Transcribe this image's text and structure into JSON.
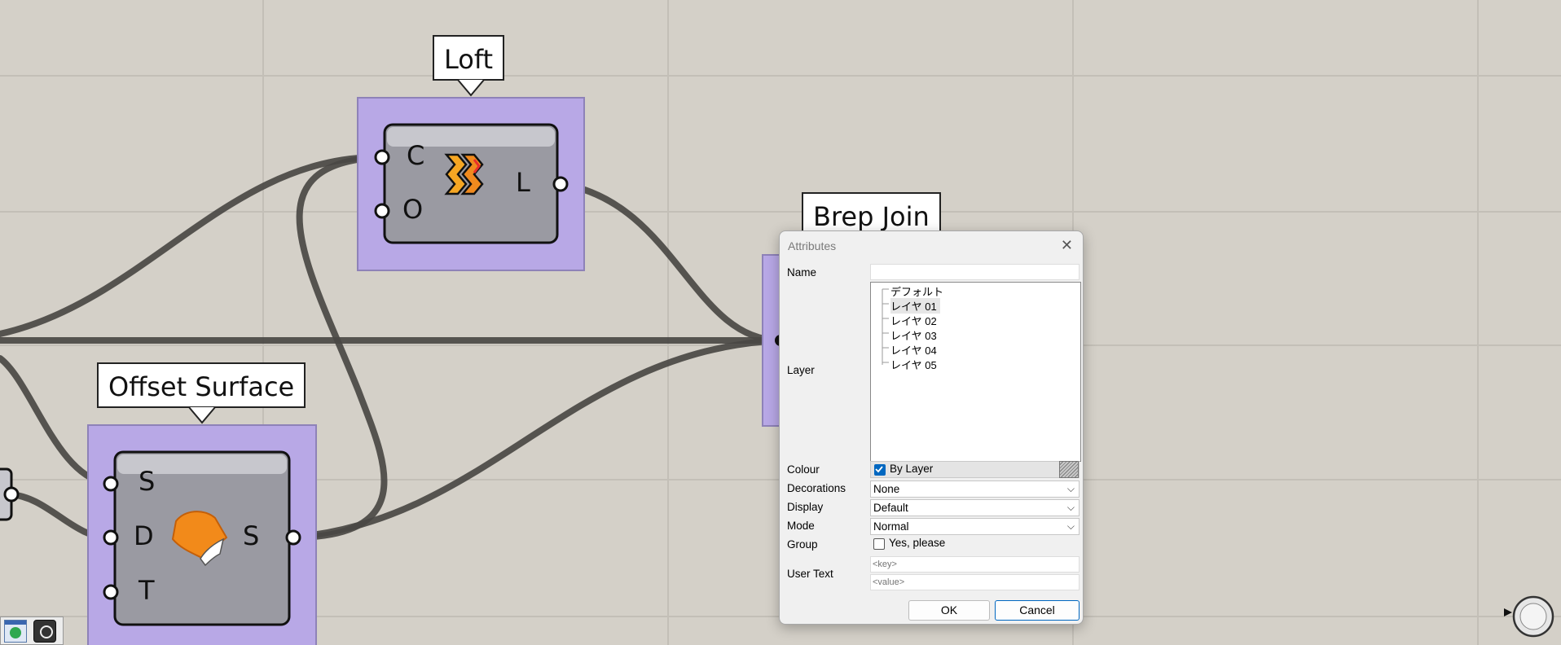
{
  "canvas": {
    "components": {
      "loft": {
        "label": "Loft",
        "inputs": [
          "C",
          "O"
        ],
        "outputs": [
          "L"
        ],
        "icon": "loft-icon"
      },
      "brep_join": {
        "label": "Brep Join"
      },
      "offset_surface": {
        "label": "Offset Surface",
        "inputs": [
          "S",
          "D",
          "T"
        ],
        "outputs": [
          "S"
        ],
        "icon": "offset-surface-icon"
      }
    },
    "colors": {
      "background": "#d4d0c8",
      "grid": "#c4c0b8",
      "wire": "#4c4a46",
      "selection": "#b9a9e6",
      "component_body": "#9b9ba3"
    }
  },
  "dialog": {
    "title": "Attributes",
    "name_label": "Name",
    "name_value": "",
    "layer_label": "Layer",
    "layers": [
      "デフォルト",
      "レイヤ 01",
      "レイヤ 02",
      "レイヤ 03",
      "レイヤ 04",
      "レイヤ 05"
    ],
    "selected_layer": "レイヤ 01",
    "colour_label": "Colour",
    "colour_option": "By Layer",
    "colour_by_layer": true,
    "decorations_label": "Decorations",
    "decorations_value": "None",
    "display_label": "Display",
    "display_value": "Default",
    "mode_label": "Mode",
    "mode_value": "Normal",
    "group_label": "Group",
    "group_option": "Yes, please",
    "group_checked": false,
    "user_text_label": "User Text",
    "user_text_key_placeholder": "<key>",
    "user_text_value_placeholder": "<value>",
    "ok_label": "OK",
    "cancel_label": "Cancel",
    "accent": "#0067c0"
  },
  "taskbar": {
    "icons": [
      "canvas-preview-icon",
      "pen-settings-icon"
    ]
  }
}
